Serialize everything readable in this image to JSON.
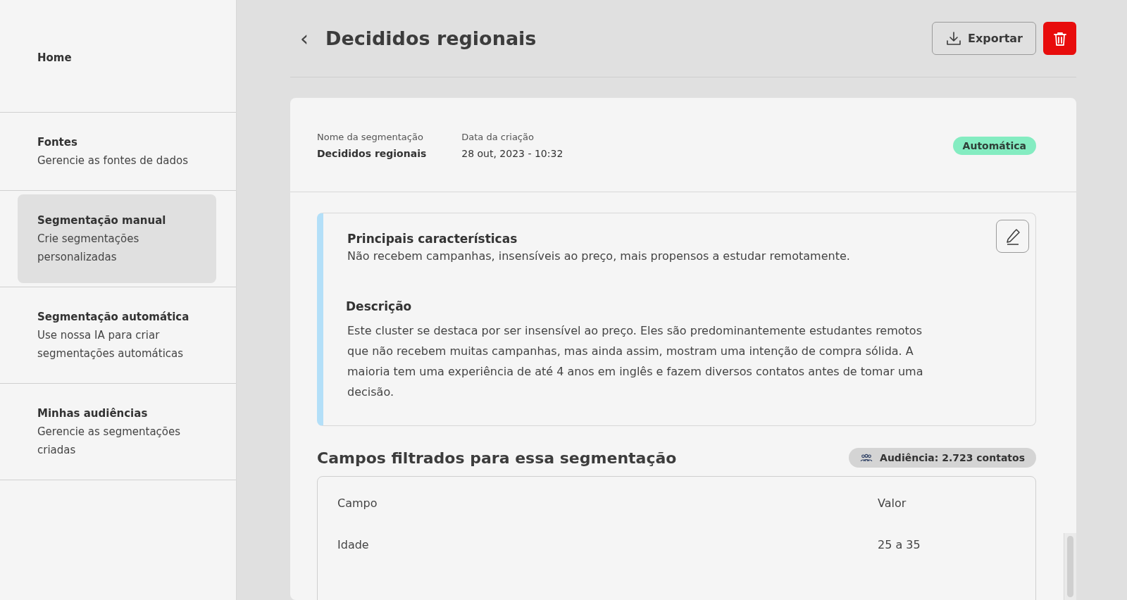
{
  "sidebar": {
    "items": [
      {
        "title": "Home",
        "selected": false
      },
      {
        "title": "Fontes",
        "subtitle": "Gerencie as fontes de dados",
        "selected": false
      },
      {
        "title": "Segmentação manual",
        "subtitle": "Crie segmentações personalizadas",
        "selected": true
      },
      {
        "title": "Segmentação automática",
        "subtitle": "Use nossa IA para criar segmentações automáticas",
        "selected": false
      },
      {
        "title": "Minhas audiências",
        "subtitle": "Gerencie as segmentações criadas",
        "selected": false
      }
    ]
  },
  "header": {
    "back": "‹",
    "title": "Decididos regionais",
    "export_button": "Exportar"
  },
  "details": {
    "fields": [
      {
        "label": "Nome da segmentação",
        "value": "Decididos regionais"
      },
      {
        "label": "Data da criação",
        "value": "28 out, 2023 - 10:32"
      }
    ],
    "badge": "Automática"
  },
  "summary": {
    "characteristics_title": "Principais características",
    "characteristics": "Não recebem campanhas, insensíveis ao preço, mais propensos a estudar remotamente.",
    "description_title": "Descrição",
    "description": "Este cluster se destaca por ser insensível ao preço. Eles são predominantemente estudantes remotos que não recebem muitas campanhas, mas ainda assim, mostram uma intenção de compra sólida. A maioria tem uma experiência de até 4 anos em inglês e fazem diversos contatos antes de tomar uma decisão."
  },
  "filters": {
    "title": "Campos filtrados para essa segmentação",
    "audience": "Audiência: 2.723 contatos",
    "table": {
      "columns": [
        "Campo",
        "Valor"
      ],
      "rows": [
        [
          "Idade",
          "25 a 35"
        ]
      ]
    }
  }
}
